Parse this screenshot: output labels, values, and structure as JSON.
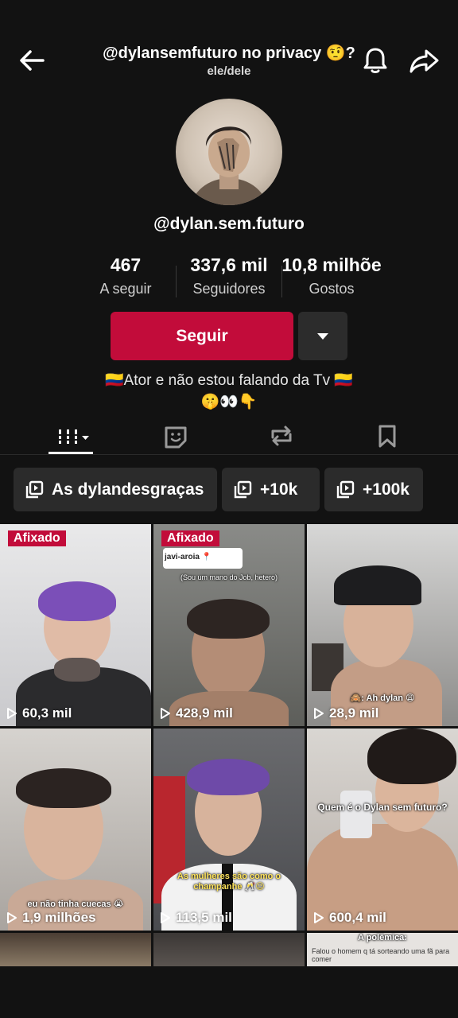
{
  "header": {
    "title": "@dylansemfuturo no privacy 🤨?",
    "pronouns": "ele/dele"
  },
  "profile": {
    "username": "@dylan.sem.futuro",
    "stats": [
      {
        "value": "467",
        "label": "A seguir"
      },
      {
        "value": "337,6 mil",
        "label": "Seguidores"
      },
      {
        "value": "10,8 milhõe",
        "label": "Gostos"
      }
    ],
    "follow_label": "Seguir",
    "bio_line1": "🇨🇴Ator e não estou falando da Tv 🇨🇴",
    "bio_line2": "🤫👀👇"
  },
  "tabs": [
    "videos-tab",
    "reposts-tab",
    "repost-tab",
    "saved-tab"
  ],
  "playlists": [
    {
      "label": "As dylandesgraças"
    },
    {
      "label": "+10k"
    },
    {
      "label": "+100k"
    }
  ],
  "videos": [
    {
      "views": "60,3 mil",
      "pinned": "Afixado",
      "caption": ""
    },
    {
      "views": "428,9 mil",
      "pinned": "Afixado",
      "caption": "(Sou um mano do Job, hetero)",
      "reply_user": "javi-aroia 📍"
    },
    {
      "views": "28,9 mil",
      "pinned": "",
      "caption": "🙈: Ah dylan 😩"
    },
    {
      "views": "1,9 milhões",
      "pinned": "",
      "caption": "eu não tinha cuecas 😭"
    },
    {
      "views": "113,5 mil",
      "pinned": "",
      "caption": "As mulheres são como o champanhe 🥂😉"
    },
    {
      "views": "600,4 mil",
      "pinned": "",
      "caption": "Quem é o Dylan sem futuro?"
    },
    {
      "views": "",
      "pinned": "",
      "caption": ""
    },
    {
      "views": "",
      "pinned": "",
      "caption": ""
    },
    {
      "views": "",
      "pinned": "",
      "caption": "A polêmica:",
      "sub": "Falou o homem q tá sorteando uma fã para comer"
    }
  ],
  "colors": {
    "accent": "#c20c3a",
    "background": "#121212"
  }
}
